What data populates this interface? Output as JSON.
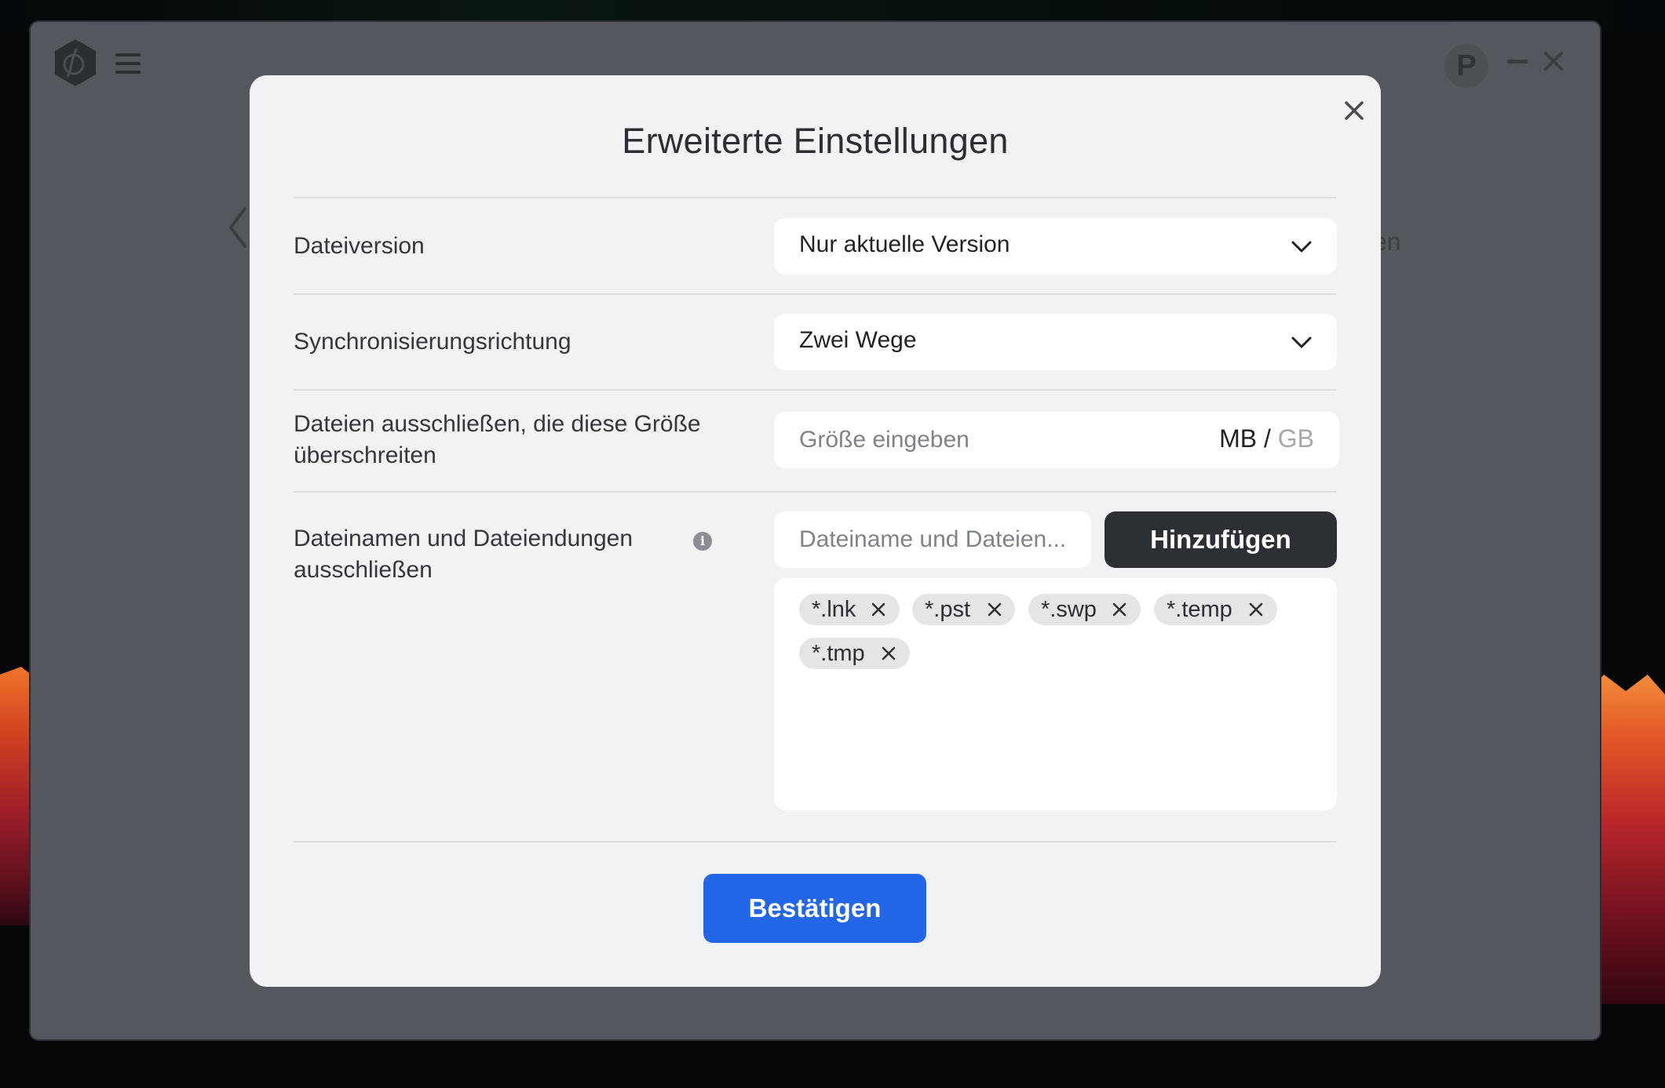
{
  "window": {
    "avatar_letter": "P",
    "background_partial_text": "en"
  },
  "modal": {
    "title": "Erweiterte Einstellungen",
    "file_version": {
      "label": "Dateiversion",
      "selected": "Nur aktuelle Version"
    },
    "sync_direction": {
      "label": "Synchronisierungsrichtung",
      "selected": "Zwei Wege"
    },
    "exclude_size": {
      "label_line1": "Dateien ausschließen, die diese Größe",
      "label_line2": "überschreiten",
      "placeholder": "Größe eingeben",
      "unit_active": "MB",
      "unit_separator": "/",
      "unit_inactive": "GB"
    },
    "exclude_names": {
      "label_line1": "Dateinamen und Dateiendungen",
      "label_line2": "ausschließen",
      "info_glyph": "i",
      "placeholder": "Dateiname und Dateien...",
      "add_label": "Hinzufügen",
      "tags": [
        "*.lnk",
        "*.pst",
        "*.swp",
        "*.temp",
        "*.tmp"
      ]
    },
    "confirm_label": "Bestätigen"
  },
  "colors": {
    "accent": "#2366e8",
    "dark_button": "#2c3034",
    "modal_bg": "#f1f2f3",
    "overlay": "#54585e"
  }
}
